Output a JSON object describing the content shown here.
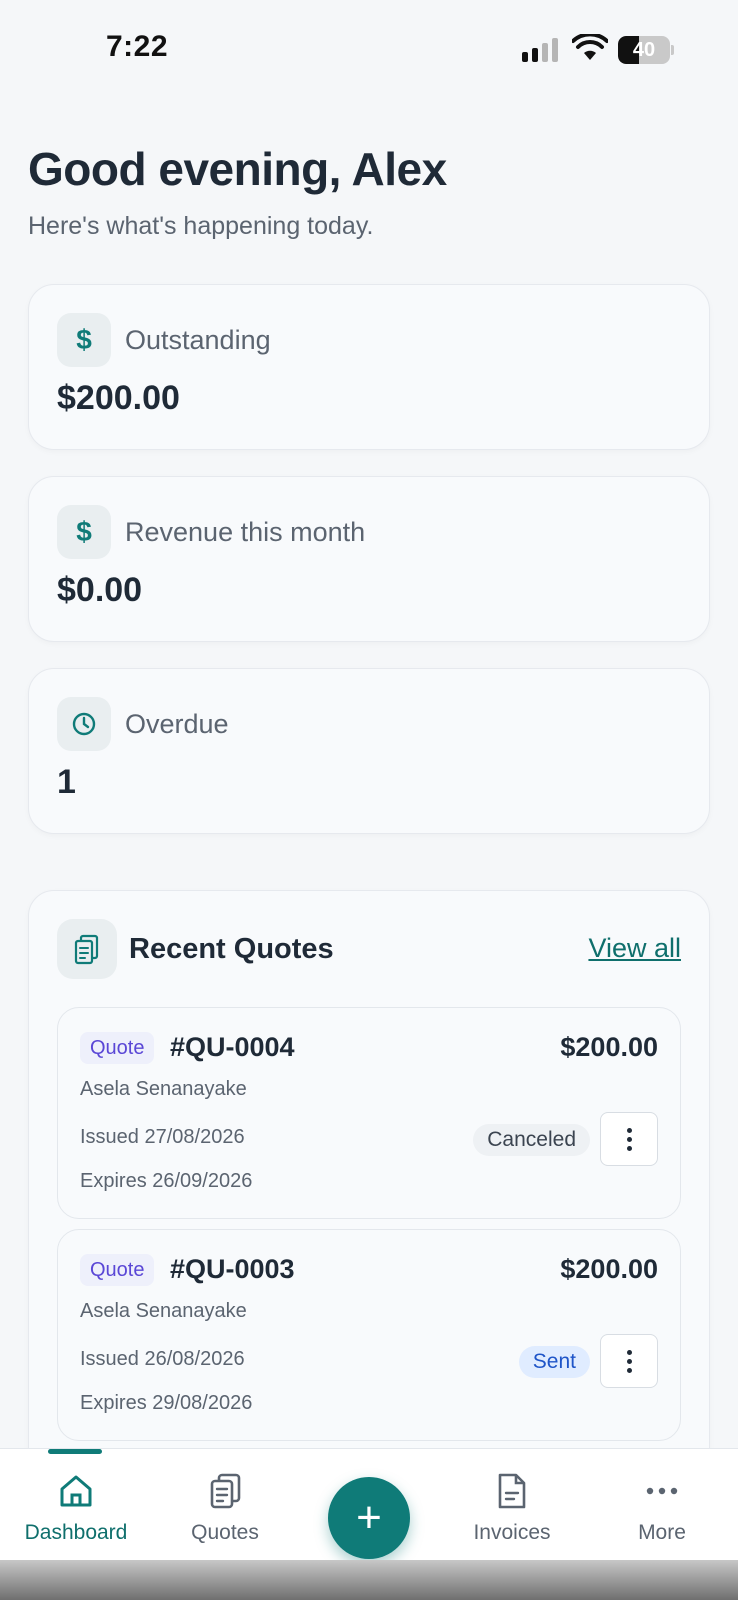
{
  "status_bar": {
    "time": "7:22",
    "battery": "40",
    "battery_level": 0.4
  },
  "header": {
    "greeting": "Good evening, Alex",
    "subtitle": "Here's what's happening today."
  },
  "stats": [
    {
      "label": "Outstanding",
      "value": "$200.00",
      "icon": "dollar-icon"
    },
    {
      "label": "Revenue this month",
      "value": "$0.00",
      "icon": "dollar-icon"
    },
    {
      "label": "Overdue",
      "value": "1",
      "icon": "clock-icon"
    }
  ],
  "recent_quotes": {
    "title": "Recent Quotes",
    "view_all": "View all",
    "items": [
      {
        "badge": "Quote",
        "number": "#QU-0004",
        "amount": "$200.00",
        "client": "Asela Senanayake",
        "issued": "Issued 27/08/2026",
        "expires": "Expires 26/09/2026",
        "status": "Canceled"
      },
      {
        "badge": "Quote",
        "number": "#QU-0003",
        "amount": "$200.00",
        "client": "Asela Senanayake",
        "issued": "Issued 26/08/2026",
        "expires": "Expires 29/08/2026",
        "status": "Sent"
      }
    ]
  },
  "nav": {
    "items": [
      {
        "label": "Dashboard",
        "icon": "home-icon",
        "active": true
      },
      {
        "label": "Quotes",
        "icon": "clipboard-icon",
        "active": false
      },
      {
        "label": "Invoices",
        "icon": "document-icon",
        "active": false
      },
      {
        "label": "More",
        "icon": "ellipsis-icon",
        "active": false
      }
    ],
    "fab_label": "+"
  },
  "colors": {
    "accent": "#0f7b78",
    "background": "#f5f7f9",
    "text": "#1f2a37",
    "quote_badge": "#5a47d6",
    "sent_status": "#1f55c8"
  }
}
